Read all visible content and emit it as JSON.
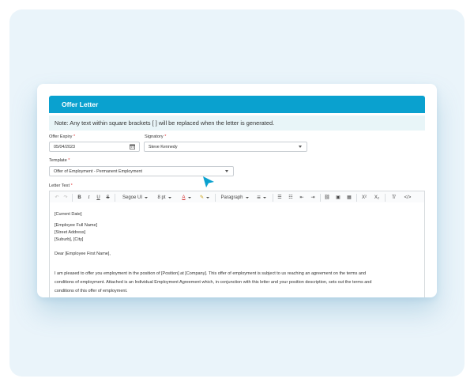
{
  "banner": {
    "title": "Offer Letter"
  },
  "note": {
    "text": "Note: Any text within square brackets [ ] will be replaced when the letter is generated."
  },
  "offer_expiry": {
    "label": "Offer Expiry",
    "required_mark": "*",
    "value": "05/04/2023"
  },
  "signatory": {
    "label": "Signatory",
    "required_mark": "*",
    "value": "Steve Kennedy"
  },
  "template": {
    "label": "Template",
    "required_mark": "*",
    "value": "Offer of Employment - Permanent Employment"
  },
  "letter_text": {
    "label": "Letter Text",
    "required_mark": "*"
  },
  "toolbar": {
    "undo": "↶",
    "redo": "↷",
    "bold": "B",
    "italic": "I",
    "underline": "U",
    "strike": "S",
    "font": "Segoe UI",
    "size": "8 pt",
    "font_color": "A",
    "highlight": "✎",
    "paragraph": "Paragraph",
    "align": "≡",
    "bullets": "☰",
    "numbers": "☷",
    "outdent": "⇤",
    "indent": "⇥",
    "link": "⛓",
    "image": "▣",
    "table": "▦",
    "superscript": "X²",
    "subscript": "X₂",
    "clear": "T̸",
    "source": "</>"
  },
  "letter": {
    "line_date": "[Current Date]",
    "line_name": "[Employee Full Name]",
    "line_street": "[Street Address]",
    "line_suburb": "[Suburb], [City]",
    "line_dear": "Dear [Employee First Name],",
    "para_1": "I am pleased to offer you employment in the position of [Position] at [Company]. This offer of employment is subject to us reaching an agreement on the terms and",
    "para_2": "conditions of employment. Attached is an Individual Employment Agreement which, in conjunction with this letter and your position description, sets out the terms and",
    "para_3": "conditions of this offer of employment."
  },
  "colors": {
    "accent": "#0aa1cf",
    "note_bg": "#e8f5f8",
    "stage_bg": "#eaf4fa",
    "required": "#e23b3b"
  }
}
